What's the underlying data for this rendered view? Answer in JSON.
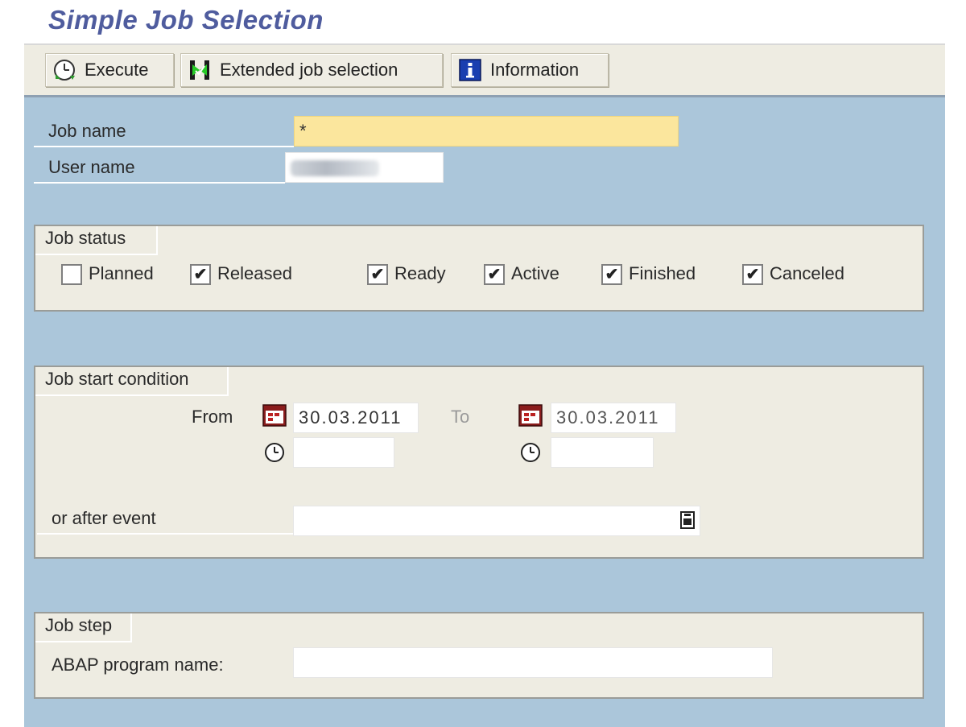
{
  "window": {
    "title": "Simple Job Selection"
  },
  "toolbar": {
    "execute_label": "Execute",
    "extended_label": "Extended job selection",
    "information_label": "Information"
  },
  "fields": {
    "job_name_label": "Job name",
    "job_name_value": "*",
    "user_name_label": "User name"
  },
  "job_status": {
    "title": "Job status",
    "items": [
      {
        "label": "Planned",
        "checked": false
      },
      {
        "label": "Released",
        "checked": true
      },
      {
        "label": "Ready",
        "checked": true
      },
      {
        "label": "Active",
        "checked": true
      },
      {
        "label": "Finished",
        "checked": true
      },
      {
        "label": "Canceled",
        "checked": true
      }
    ]
  },
  "job_start": {
    "title": "Job start condition",
    "from_label": "From",
    "from_date": "30.03.2011",
    "to_label": "To",
    "to_date": "30.03.2011",
    "from_time": "",
    "to_time": "",
    "event_label": "or after event",
    "event_value": ""
  },
  "job_step": {
    "title": "Job step",
    "program_label": "ABAP program name",
    "program_value": ""
  },
  "colors": {
    "content_bg": "#abc6da",
    "group_bg": "#eeece2",
    "toolbar_bg": "#eeece2",
    "highlight_field": "#fbe69d",
    "title_color": "#4f5c9e"
  },
  "icons": {
    "execute": "execute-clock-icon",
    "extended": "extended-selection-icon",
    "information": "information-icon",
    "calendar": "calendar-icon",
    "clock": "clock-icon",
    "event_picker": "event-picker-icon"
  }
}
